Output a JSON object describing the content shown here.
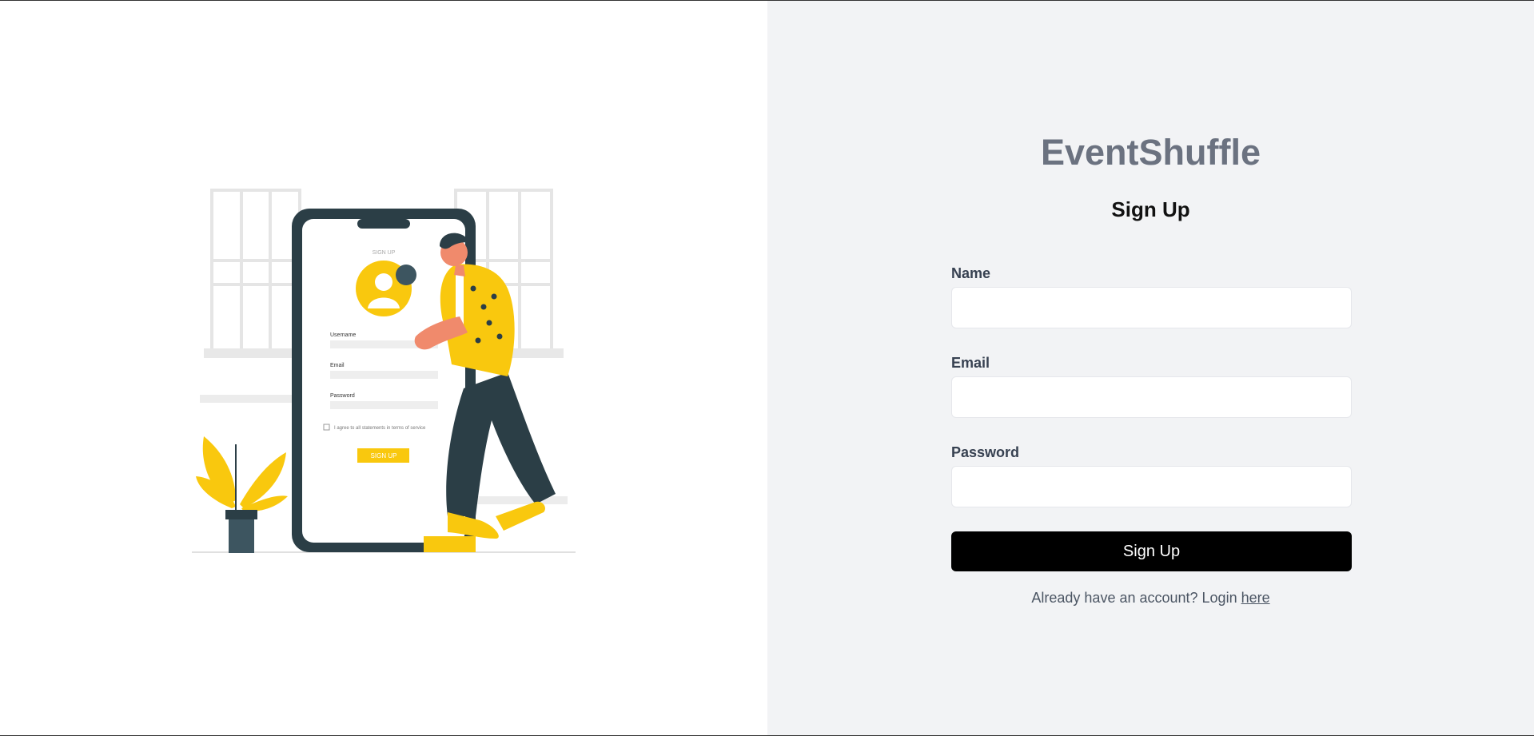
{
  "brand": {
    "title": "EventShuffle"
  },
  "form": {
    "heading": "Sign Up",
    "name_label": "Name",
    "email_label": "Email",
    "password_label": "Password",
    "submit_label": "Sign Up"
  },
  "footer": {
    "prompt": "Already have an account? Login ",
    "link": "here"
  },
  "illustration": {
    "phone": {
      "title": "SIGN UP",
      "username_label": "Username",
      "email_label": "Email",
      "password_label": "Password",
      "terms_text": "I agree to all statements in terms of service",
      "button_label": "SIGN UP"
    },
    "colors": {
      "accent": "#f9c80e",
      "dark": "#2b3e46",
      "skin": "#f08a6c"
    }
  }
}
